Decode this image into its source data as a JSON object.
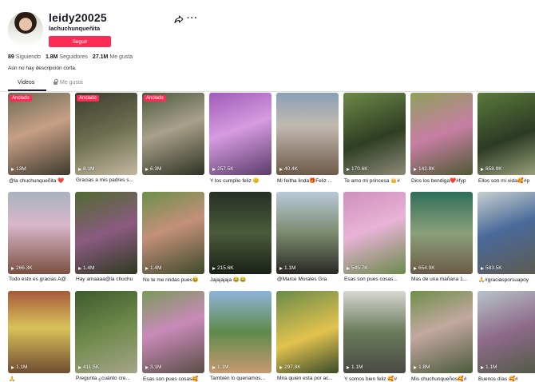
{
  "profile": {
    "username": "leidy20025",
    "nickname": "lachuchunqueñita",
    "follow_label": "Seguir",
    "bio": "Aún no hay descripción corta.",
    "stats": [
      {
        "value": "89",
        "label": "Siguiendo"
      },
      {
        "value": "1.8M",
        "label": "Seguidores"
      },
      {
        "value": "27.1M",
        "label": "Me gusta"
      }
    ]
  },
  "tabs": {
    "videos": "Videos",
    "liked": "Me gusta"
  },
  "pinned_label": "Anclado",
  "videos": [
    {
      "views": "13M",
      "caption": "@la chuchunqueñita ❤️",
      "pinned": true,
      "bg": "linear-gradient(160deg,#6b6a55,#c79f86 45%,#3e3a2c)"
    },
    {
      "views": "8.1M",
      "caption": "Gracias a mis padres s...",
      "pinned": true,
      "bg": "linear-gradient(160deg,#3b3d2e,#6c6f4f 50%,#c4b7a0)"
    },
    {
      "views": "6.3M",
      "caption": "",
      "pinned": true,
      "bg": "linear-gradient(160deg,#4c5a3d,#a9a08a 45%,#2e3322)"
    },
    {
      "views": "257.5K",
      "caption": "Y los cumplio feliz 😊",
      "pinned": false,
      "bg": "linear-gradient(160deg,#a05bb8,#d69be0 45%,#5a3c6b)"
    },
    {
      "views": "40.4K",
      "caption": "Mi feitha linda🎁Feliz ...",
      "pinned": false,
      "bg": "linear-gradient(180deg,#8aa0b7,#c2b9b0 40%,#6e5a4a)"
    },
    {
      "views": "170.6K",
      "caption": "Te amo mi princesa 👑#",
      "pinned": false,
      "bg": "linear-gradient(160deg,#6d8a48,#2f3e23 55%,#8d8a77)"
    },
    {
      "views": "142.8K",
      "caption": "Dios los bendiga❤️#fyp",
      "pinned": false,
      "bg": "linear-gradient(160deg,#8ea05c,#c77ea3 50%,#4e5a32)"
    },
    {
      "views": "858.9K",
      "caption": "Ellos son mi vida🥰#p",
      "pinned": false,
      "bg": "linear-gradient(160deg,#5a7a3a,#2c3a24 55%,#9ba37a)"
    },
    {
      "views": "266.3K",
      "caption": "Todo esto es gracias A@",
      "pinned": false,
      "bg": "linear-gradient(180deg,#a9b3bf,#d9b7cb 40%,#7a5040)"
    },
    {
      "views": "1.4M",
      "caption": "Hay amaaaa@la chuchu",
      "pinned": false,
      "bg": "linear-gradient(160deg,#4f6a30,#8b5a80 50%,#2d3a20)"
    },
    {
      "views": "1.4M",
      "caption": "No te me rindas pues😆",
      "pinned": false,
      "bg": "linear-gradient(160deg,#6c8f4a,#c4907a 45%,#3d4a2b)"
    },
    {
      "views": "215.6K",
      "caption": "Jajajajaja 😂😂",
      "pinned": false,
      "bg": "linear-gradient(180deg,#263024,#4b5a3a 50%,#1a2116)"
    },
    {
      "views": "1.1M",
      "caption": "@Marce Morales Gra",
      "pinned": false,
      "bg": "linear-gradient(180deg,#b8c9da,#7b8a6d 50%,#2a2724)"
    },
    {
      "views": "545.7K",
      "caption": "Esas son pues cosas...",
      "pinned": false,
      "bg": "linear-gradient(160deg,#cf8fbd,#e9b3d7 45%,#6a8a4a)"
    },
    {
      "views": "654.9K",
      "caption": "Mas de una mañana 1...",
      "pinned": false,
      "bg": "linear-gradient(180deg,#2f6e5a,#8aa07a 50%,#6b5a46)"
    },
    {
      "views": "583.5K",
      "caption": "🙏#graciasporsuapoy",
      "pinned": false,
      "bg": "linear-gradient(160deg,#c9d0cf,#4a6a9a 45%,#5d5a4e)"
    },
    {
      "views": "1.1M",
      "caption": "🙏",
      "pinned": false,
      "bg": "linear-gradient(180deg,#a55a3a,#d9c25a 45%,#6e4c30)"
    },
    {
      "views": "411.5K",
      "caption": "Pregunta ¿cuánto cre...",
      "pinned": false,
      "bg": "linear-gradient(160deg,#3d5a2e,#6f8a4a 50%,#a6a48a)"
    },
    {
      "views": "3.1M",
      "caption": "Esas son pues cosas🥰",
      "pinned": false,
      "bg": "linear-gradient(160deg,#7a9a5a,#c98ab9 45%,#5a4e45)"
    },
    {
      "views": "1.1M",
      "caption": "También lo queriamos...",
      "pinned": false,
      "bg": "linear-gradient(180deg,#8fb3d9,#5f8a4a 50%,#c79a70)"
    },
    {
      "views": "297.8K",
      "caption": "Mira quien esta por ac...",
      "pinned": false,
      "bg": "linear-gradient(160deg,#6a8a4a,#e2c34e 55%,#3a4a2a)"
    },
    {
      "views": "1.1M",
      "caption": "Y somos bien feliz 🥰#",
      "pinned": false,
      "bg": "linear-gradient(180deg,#d7d7d2,#6a7a5a 50%,#4a4a45)"
    },
    {
      "views": "1.8M",
      "caption": "Mis chuchunqueños🥰#",
      "pinned": false,
      "bg": "linear-gradient(160deg,#6e8f4a,#c3a8a0 45%,#4a5a3a)"
    },
    {
      "views": "1.1M",
      "caption": "Buenos días 🥰#",
      "pinned": false,
      "bg": "linear-gradient(160deg,#b7c4c8,#8e6a8a 50%,#4f5a45)"
    }
  ]
}
